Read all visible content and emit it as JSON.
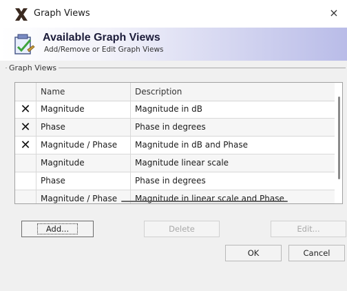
{
  "window": {
    "title": "Graph Views",
    "close_glyph": "×",
    "app_icon": "x-logo-icon"
  },
  "banner": {
    "title": "Available Graph Views",
    "subtitle": "Add/Remove or Edit Graph Views",
    "icon": "graph-checklist-icon"
  },
  "group": {
    "label": "Graph Views"
  },
  "table": {
    "columns": [
      "",
      "Name",
      "Description"
    ],
    "rows": [
      {
        "mark": "✕",
        "name": "Magnitude",
        "description": "Magnitude in dB"
      },
      {
        "mark": "✕",
        "name": "Phase",
        "description": "Phase in degrees"
      },
      {
        "mark": "✕",
        "name": "Magnitude / Phase",
        "description": "Magnitude in dB and Phase"
      },
      {
        "mark": "",
        "name": "Magnitude",
        "description": "Magnitude linear scale"
      },
      {
        "mark": "",
        "name": "Phase",
        "description": "Phase in degrees"
      },
      {
        "mark": "",
        "name": "Magnitude / Phase",
        "description": "Magnitude in linear scale and Phase"
      }
    ]
  },
  "buttons": {
    "add": "Add...",
    "delete": "Delete",
    "edit": "Edit...",
    "ok": "OK",
    "cancel": "Cancel"
  }
}
